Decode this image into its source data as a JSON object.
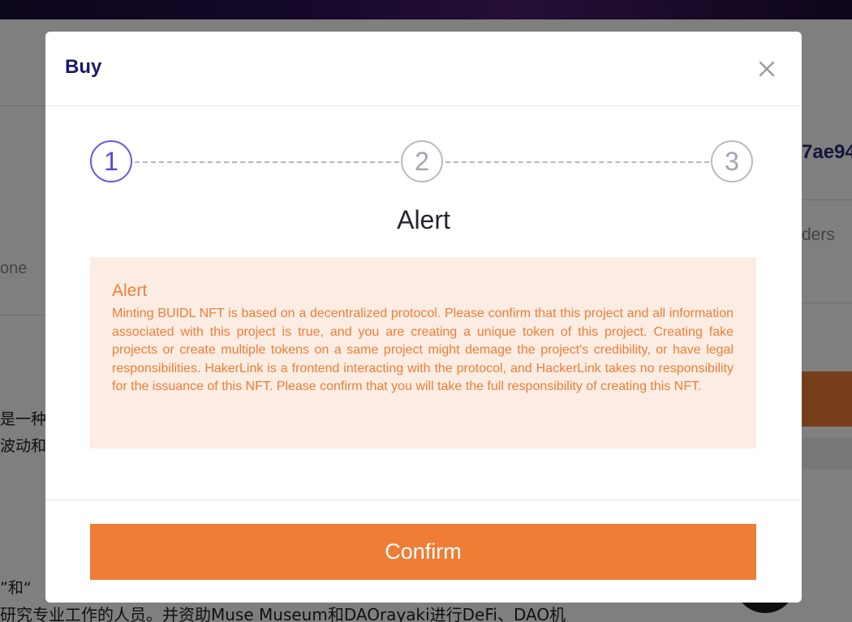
{
  "background": {
    "left_partial_text": "one",
    "chinese_line_1": "是一种",
    "chinese_line_2": "波动和",
    "chinese_line_3": "”和“",
    "chinese_line_4": "研究专业工作的人员。并资助Muse Museum和DAOrayaki进行DeFi、DAO机",
    "right_hash_partial": "7ae94",
    "right_label_partial": "ders"
  },
  "modal": {
    "title": "Buy",
    "close_icon": "close-icon",
    "steps": [
      {
        "label": "1",
        "state": "active"
      },
      {
        "label": "2",
        "state": "inactive"
      },
      {
        "label": "3",
        "state": "inactive"
      }
    ],
    "step_heading": "Alert",
    "alert": {
      "title": "Alert",
      "text": "Minting BUIDL NFT is based on a decentralized protocol. Please confirm that this project and all information associated with this project is true, and you are creating a unique token of this project. Creating fake projects or create multiple tokens on a same project might demage the project's credibility, or have legal responsibilities. HakerLink is a frontend interacting with the protocol, and HackerLink takes no responsibility for the issuance of this NFT. Please confirm that you will take the full responsibility of creating this NFT."
    },
    "confirm_label": "Confirm"
  },
  "colors": {
    "accent_orange": "#ef7d36",
    "alert_bg": "#fbede3",
    "active_step": "#6a55e6",
    "title_navy": "#1b1a6b",
    "overlay": "rgba(0,0,0,0.5)"
  }
}
